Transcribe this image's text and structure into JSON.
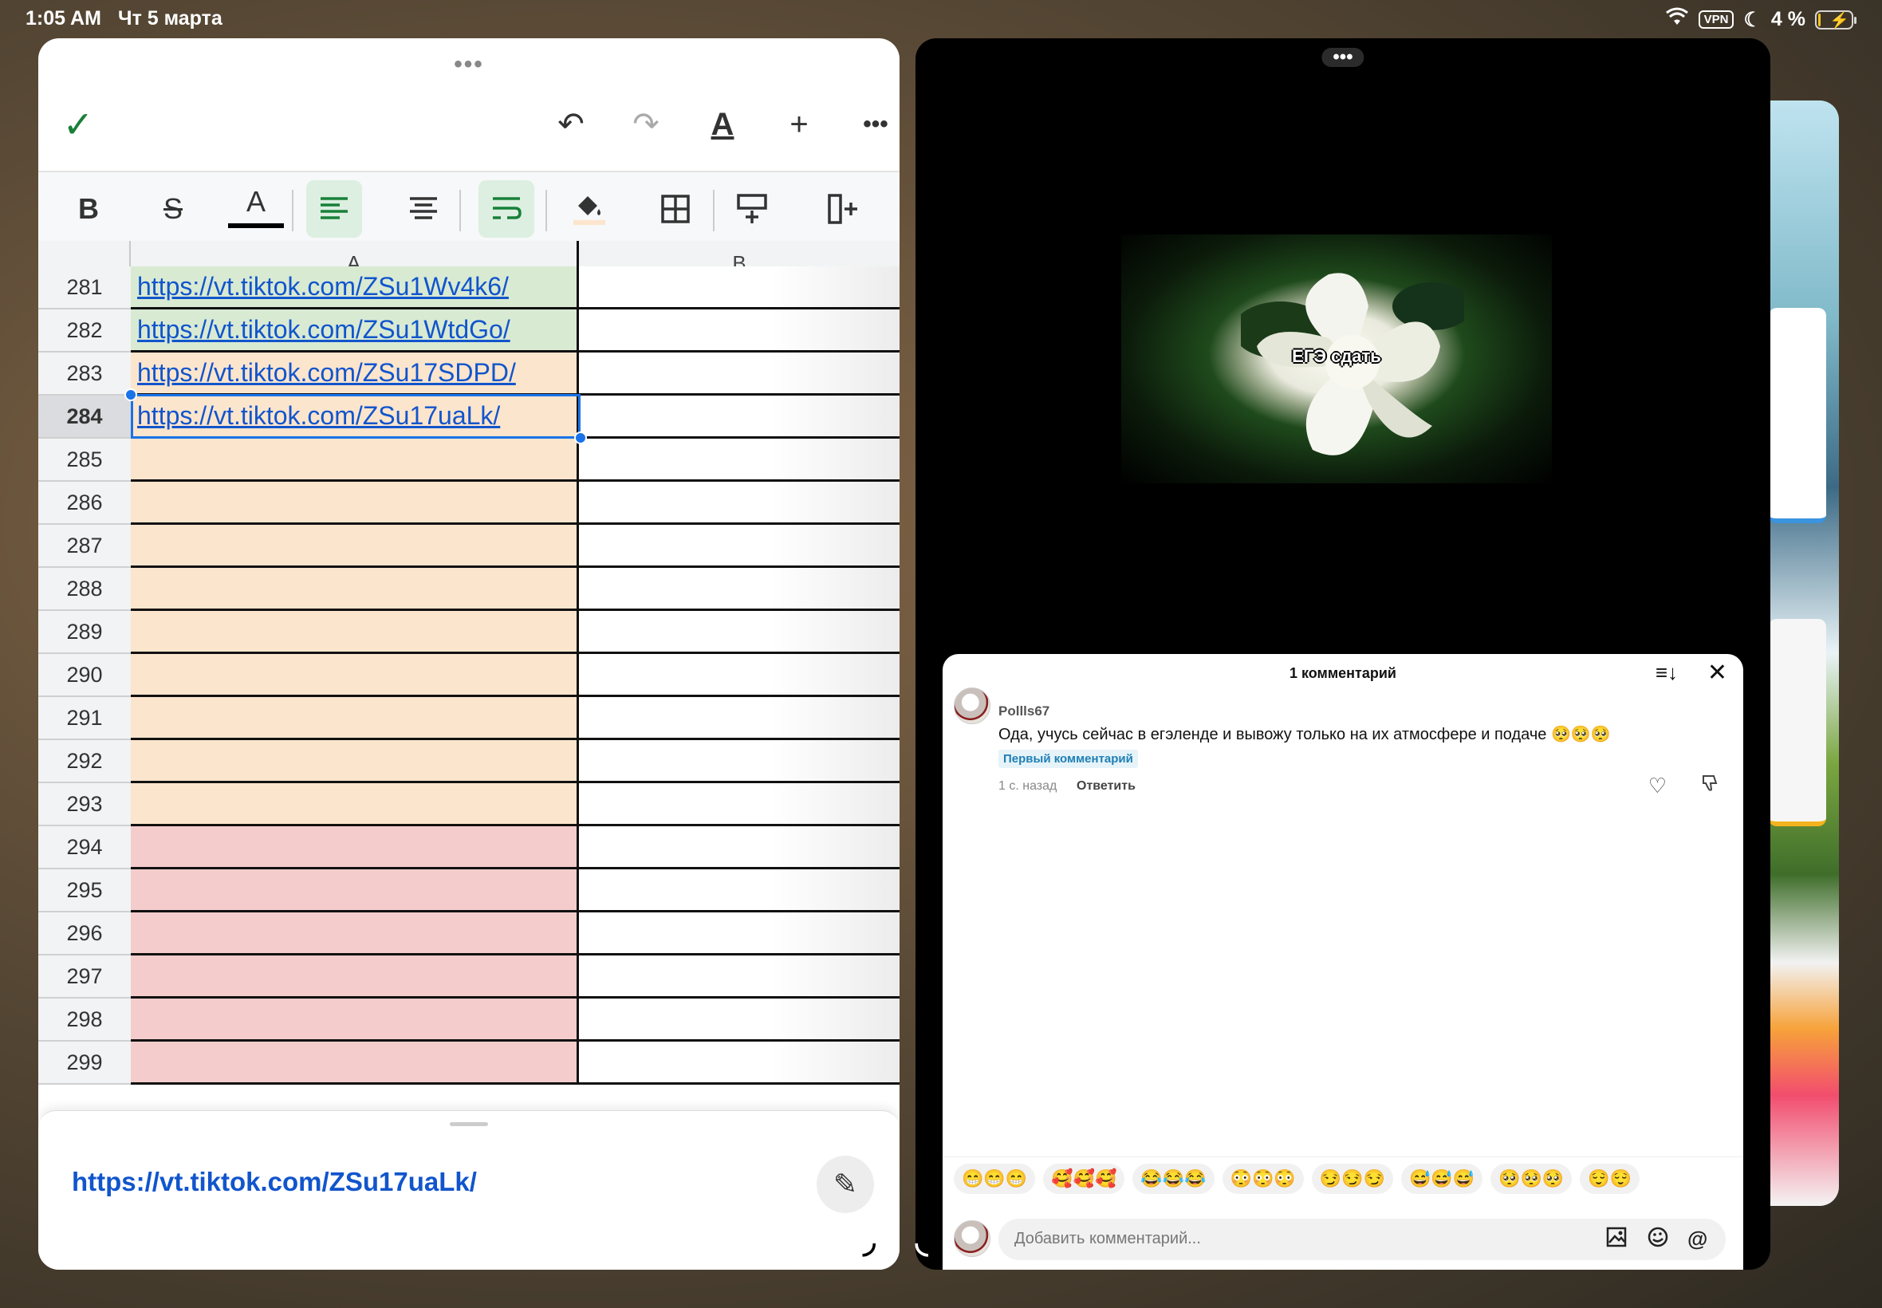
{
  "status_bar": {
    "time": "1:05 AM",
    "date": "Чт 5 марта",
    "vpn": "VPN",
    "battery_pct": "4 %",
    "battery_level": 0.04
  },
  "sheets": {
    "col_a": "A",
    "col_b": "B",
    "rows": [
      {
        "num": "281",
        "a": "https://vt.tiktok.com/ZSu1Wv4k6/",
        "color": "#d9ead3"
      },
      {
        "num": "282",
        "a": "https://vt.tiktok.com/ZSu1WtdGo/",
        "color": "#d9ead3"
      },
      {
        "num": "283",
        "a": "https://vt.tiktok.com/ZSu17SDPD/",
        "color": "#fce5cd"
      },
      {
        "num": "284",
        "a": "https://vt.tiktok.com/ZSu17uaLk/",
        "color": "#fce5cd"
      },
      {
        "num": "285",
        "a": "",
        "color": "#fce5cd"
      },
      {
        "num": "286",
        "a": "",
        "color": "#fce5cd"
      },
      {
        "num": "287",
        "a": "",
        "color": "#fce5cd"
      },
      {
        "num": "288",
        "a": "",
        "color": "#fce5cd"
      },
      {
        "num": "289",
        "a": "",
        "color": "#fce5cd"
      },
      {
        "num": "290",
        "a": "",
        "color": "#fce5cd"
      },
      {
        "num": "291",
        "a": "",
        "color": "#fce5cd"
      },
      {
        "num": "292",
        "a": "",
        "color": "#fce5cd"
      },
      {
        "num": "293",
        "a": "",
        "color": "#fce5cd"
      },
      {
        "num": "294",
        "a": "",
        "color": "#f4cccc"
      },
      {
        "num": "295",
        "a": "",
        "color": "#f4cccc"
      },
      {
        "num": "296",
        "a": "",
        "color": "#f4cccc"
      },
      {
        "num": "297",
        "a": "",
        "color": "#f4cccc"
      },
      {
        "num": "298",
        "a": "",
        "color": "#f4cccc"
      },
      {
        "num": "299",
        "a": "",
        "color": "#f4cccc"
      }
    ],
    "selected_row": "284",
    "cell_preview": "https://vt.tiktok.com/ZSu17uaLk/"
  },
  "video": {
    "caption": "ЕГЭ сдать",
    "comments": {
      "title": "1 комментарий",
      "items": [
        {
          "user": "Pollls67",
          "text": "Ода, учусь сейчас в егэленде и вывожу только на их атмосфере и подаче 🥺🥺🥺",
          "badge": "Первый комментарий",
          "time": "1 с. назад",
          "reply": "Ответить"
        }
      ],
      "emoji_chips": [
        "😁😁😁",
        "🥰🥰🥰",
        "😂😂😂",
        "😳😳😳",
        "😏😏😏",
        "😅😅😅",
        "🥺🥺🥺",
        "😌😌"
      ],
      "input_placeholder": "Добавить комментарий..."
    }
  },
  "colors": {
    "link": "#1155cc",
    "accent_green": "#188038",
    "selection": "#1a73e8"
  }
}
